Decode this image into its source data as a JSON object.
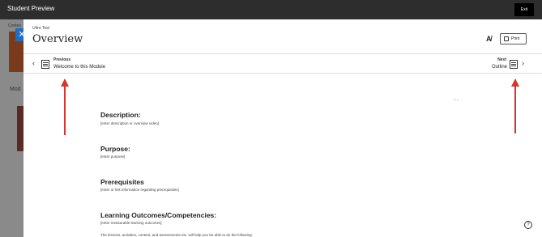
{
  "topbar": {
    "title": "Student Preview",
    "exit_label": "Exit"
  },
  "background": {
    "tab": "Conten",
    "module": "Mod"
  },
  "panel": {
    "breadcrumb": "Ultra Test",
    "title": "Overview",
    "print_label": "Print"
  },
  "nav": {
    "previous_caption": "Previous",
    "previous_title": "Welcome to this Module",
    "next_caption": "Next",
    "next_title": "Outline"
  },
  "content": {
    "more": "…",
    "description_heading": "Description:",
    "description_text": "[enter description or overview video]",
    "purpose_heading": "Purpose:",
    "purpose_text": "[enter purpose]",
    "prereq_heading": "Prerequisites",
    "prereq_text": "[enter or link information regarding prerequisites]",
    "outcomes_heading": "Learning Outcomes/Competencies:",
    "outcomes_text": "[enter measurable learning outcomes]",
    "lessons_text": "The lessons, activities, content, and assessments etc. will help you be able to do the following:"
  },
  "help": "?",
  "annotation_color": "#d9342b"
}
